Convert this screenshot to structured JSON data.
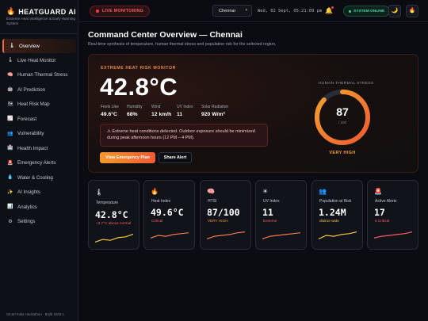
{
  "brand": {
    "name": "HEATGUARD AI",
    "subtitle": "Extreme Heat Intelligence & Early Warning System",
    "icon": "flame-icon"
  },
  "topbar": {
    "live_label": "LIVE MONITORING",
    "city": "Chennai",
    "datetime": "Wed, 02 Sept, 05:21:09 pm",
    "system_status": "SYSTEM ONLINE",
    "icons": [
      "bell-icon",
      "moon-icon",
      "flame-icon"
    ]
  },
  "sidebar": {
    "items": [
      {
        "label": "Overview",
        "icon": "thermometer-icon",
        "active": true
      },
      {
        "label": "Live Heat Monitor",
        "icon": "thermometer-icon"
      },
      {
        "label": "Human Thermal Stress",
        "icon": "brain-icon"
      },
      {
        "label": "AI Prediction",
        "icon": "robot-icon"
      },
      {
        "label": "Heat Risk Map",
        "icon": "map-icon"
      },
      {
        "label": "Forecast",
        "icon": "chart-icon"
      },
      {
        "label": "Vulnerability",
        "icon": "people-icon"
      },
      {
        "label": "Health Impact",
        "icon": "hospital-icon"
      },
      {
        "label": "Emergency Alerts",
        "icon": "siren-icon"
      },
      {
        "label": "Water & Cooling",
        "icon": "droplet-icon"
      },
      {
        "label": "AI Insights",
        "icon": "sparkle-icon"
      },
      {
        "label": "Analytics",
        "icon": "bar-chart-icon"
      },
      {
        "label": "Settings",
        "icon": "gear-icon"
      }
    ],
    "footer": "Smart India Hackathon · Build 2026.1"
  },
  "page": {
    "title": "Command Center Overview — Chennai",
    "subtitle": "Real-time synthesis of temperature, human thermal stress and population risk for the selected region."
  },
  "hero": {
    "label": "EXTREME HEAT RISK MONITOR",
    "temperature": "42.8°C",
    "stats": [
      {
        "label": "Feels Like",
        "value": "49.6°C"
      },
      {
        "label": "Humidity",
        "value": "68%"
      },
      {
        "label": "Wind",
        "value": "12 km/h"
      },
      {
        "label": "UV Index",
        "value": "11"
      },
      {
        "label": "Solar Radiation",
        "value": "920 W/m²"
      }
    ],
    "alert": "⚠ Extreme heat conditions detected. Outdoor exposure should be minimized during peak afternoon hours (12 PM – 4 PM).",
    "primary_button": "View Emergency Plan",
    "secondary_button": "Share Alert",
    "gauge": {
      "label": "HUMAN THERMAL STRESS",
      "value": "87",
      "max": "/ 100",
      "fraction": 0.87,
      "level": "VERY HIGH"
    }
  },
  "cards": [
    {
      "icon": "thermometer-icon",
      "label": "Temperature",
      "value": "42.8°C",
      "note": "+3.7°C above normal",
      "note_color": "#ff5a5f",
      "spark_color": "#f5c242",
      "trend": [
        0.3,
        0.45,
        0.4,
        0.55,
        0.6,
        0.75
      ]
    },
    {
      "icon": "flame-icon",
      "label": "Heat Index",
      "value": "49.6°C",
      "note": "Critical",
      "note_color": "#ff5a5f",
      "spark_color": "#f07a4a",
      "trend": [
        0.35,
        0.5,
        0.45,
        0.55,
        0.6,
        0.65
      ]
    },
    {
      "icon": "brain-icon",
      "label": "HTSI",
      "value": "87/100",
      "note": "VERY HIGH",
      "note_color": "#f59a2c",
      "spark_color": "#f07a4a",
      "trend": [
        0.3,
        0.45,
        0.5,
        0.55,
        0.65,
        0.7
      ]
    },
    {
      "icon": "sun-icon",
      "label": "UV Index",
      "value": "11",
      "note": "Extreme",
      "note_color": "#ff5a5f",
      "spark_color": "#f07a4a",
      "trend": [
        0.3,
        0.45,
        0.5,
        0.55,
        0.6,
        0.65
      ]
    },
    {
      "icon": "people-icon",
      "label": "Population at Risk",
      "value": "1.24M",
      "note": "district-wide",
      "note_color": "#f5c242",
      "spark_color": "#f5c242",
      "trend": [
        0.3,
        0.5,
        0.45,
        0.55,
        0.6,
        0.7
      ]
    },
    {
      "icon": "siren-icon",
      "label": "Active Alerts",
      "value": "17",
      "note": "5 Critical",
      "note_color": "#ff5a5f",
      "spark_color": "#ff5a5f",
      "trend": [
        0.35,
        0.45,
        0.5,
        0.55,
        0.6,
        0.7
      ]
    }
  ]
}
